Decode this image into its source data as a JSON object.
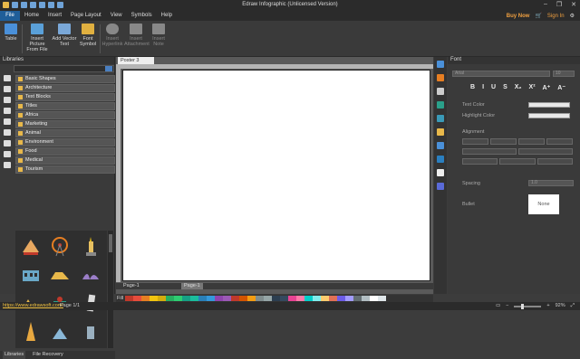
{
  "app": {
    "title": "Edraw Infographic (Unlicensed Version)",
    "window_buttons": [
      "–",
      "❐",
      "✕"
    ]
  },
  "menu": {
    "file": "File",
    "items": [
      "Home",
      "Insert",
      "Page Layout",
      "View",
      "Symbols",
      "Help"
    ],
    "buy_now": "Buy Now",
    "sign_in": "Sign In"
  },
  "ribbon": {
    "buttons": [
      {
        "label": "Table",
        "color": "#4a90d9",
        "disabled": false
      },
      {
        "label": "Insert Picture From File",
        "color": "#5aa0d8",
        "disabled": false
      },
      {
        "label": "Add Vector Text",
        "color": "#7aa8d8",
        "disabled": false
      },
      {
        "label": "Font Symbol",
        "color": "#e0b040",
        "disabled": false
      },
      {
        "label": "Insert Hyperlink",
        "color": "#888888",
        "disabled": true
      },
      {
        "label": "Insert Attachment",
        "color": "#888888",
        "disabled": true
      },
      {
        "label": "Insert Note",
        "color": "#888888",
        "disabled": true
      }
    ]
  },
  "libraries": {
    "title": "Libraries",
    "items": [
      "Basic Shapes",
      "Architecture",
      "Text Blocks",
      "Titles",
      "Africa",
      "Marketing",
      "Animal",
      "Environment",
      "Food",
      "Medical",
      "Tourism"
    ],
    "tabs": [
      "Libraries",
      "File Recovery"
    ]
  },
  "canvas": {
    "doc_tab": "Poster 3",
    "page_label": "Page-1",
    "page_tab": "Page-1"
  },
  "fill_bar": {
    "label": "Fill",
    "colors": [
      "#c0392b",
      "#e74c3c",
      "#e67e22",
      "#f1c40f",
      "#d4ac0d",
      "#27ae60",
      "#2ecc71",
      "#16a085",
      "#1abc9c",
      "#2980b9",
      "#3498db",
      "#8e44ad",
      "#9b59b6",
      "#c0392b",
      "#d35400",
      "#f39c12",
      "#7f8c8d",
      "#95a5a6",
      "#2c3e50",
      "#34495e",
      "#e84393",
      "#fd79a8",
      "#00cec9",
      "#81ecec",
      "#fdcb6e",
      "#e17055",
      "#6c5ce7",
      "#a29bfe",
      "#636e72",
      "#b2bec3",
      "#ffffff",
      "#dfe6e9"
    ]
  },
  "font_panel": {
    "title": "Font",
    "format_buttons": [
      "B",
      "I",
      "U",
      "S",
      "X₂",
      "X²",
      "A⁺",
      "A⁻"
    ],
    "text_color_label": "Text Color",
    "highlight_label": "Highlight Color",
    "alignment_label": "Alignment",
    "spacing_label": "Spacing",
    "spacing_value": "1.0",
    "bullet_label": "Bullet",
    "bullet_value": "None",
    "font_value": "Arial",
    "size_value": "10"
  },
  "status": {
    "url": "https://www.edrawsoft.com/",
    "page": "Page 1/1",
    "zoom": "92%"
  }
}
